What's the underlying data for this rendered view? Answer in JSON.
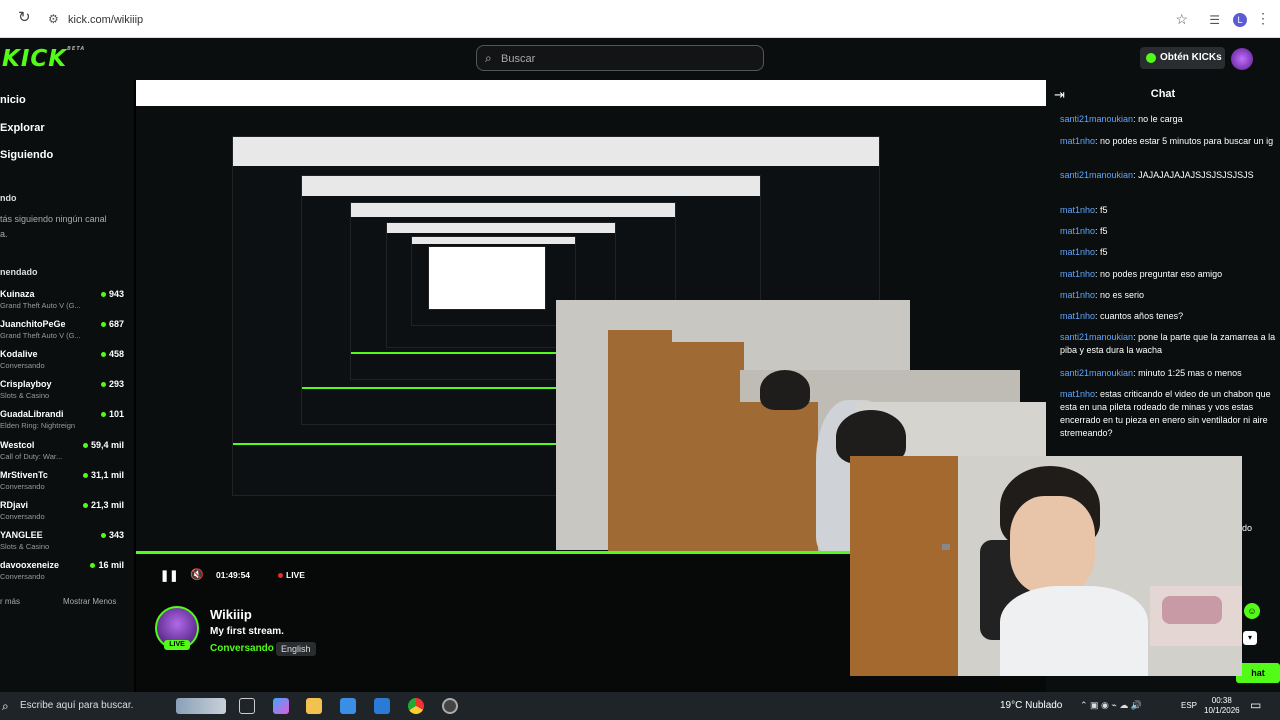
{
  "browser": {
    "url": "kick.com/wikiiip"
  },
  "header": {
    "logo": "KICK",
    "logo_beta": "BETA",
    "search_placeholder": "Buscar",
    "get_kicks": "Obtén KICKs",
    "accent": "#53fc18"
  },
  "sidebar": {
    "nav": [
      "nicio",
      "Explorar",
      "Siguiendo"
    ],
    "following_title": "ndo",
    "following_empty_1": "tás siguiendo ningún canal",
    "following_empty_2": "a.",
    "recommended_title": "nendado",
    "channels": [
      {
        "name": "Kuinaza",
        "game": "Grand Theft Auto V (G...",
        "viewers": "943"
      },
      {
        "name": "JuanchitoPeGe",
        "game": "Grand Theft Auto V (G...",
        "viewers": "687"
      },
      {
        "name": "Kodalive",
        "game": "Conversando",
        "viewers": "458"
      },
      {
        "name": "Crisplayboy",
        "game": "Slots & Casino",
        "viewers": "293"
      },
      {
        "name": "GuadaLibrandi",
        "game": "Elden Ring: Nightreign",
        "viewers": "101"
      },
      {
        "name": "Westcol",
        "game": "Call of Duty: War...",
        "viewers": "59,4 mil"
      },
      {
        "name": "MrStivenTc",
        "game": "Conversando",
        "viewers": "31,1 mil"
      },
      {
        "name": "RDjavi",
        "game": "Conversando",
        "viewers": "21,3 mil"
      },
      {
        "name": "YANGLEE",
        "game": "Slots & Casino",
        "viewers": "343"
      },
      {
        "name": "davooxeneize",
        "game": "Conversando",
        "viewers": "16 mil"
      }
    ],
    "show_more": "r más",
    "show_less": "Mostrar Menos"
  },
  "player": {
    "time": "01:49:54",
    "live": "LIVE"
  },
  "channel": {
    "name": "Wikiiip",
    "title": "My first stream.",
    "category": "Conversando",
    "language": "English",
    "live_badge": "LIVE"
  },
  "chat": {
    "title": "Chat",
    "messages": [
      {
        "user": "santi21manoukian",
        "text": ": no le carga"
      },
      {
        "user": "mat1nho",
        "text": ": no podes estar 5 minutos para buscar un ig"
      },
      {
        "user": "santi21manoukian",
        "text": ": JAJAJAJAJAJSJSJSJSJSJS"
      },
      {
        "user": "mat1nho",
        "text": ": f5"
      },
      {
        "user": "mat1nho",
        "text": ": f5"
      },
      {
        "user": "mat1nho",
        "text": ": f5"
      },
      {
        "user": "mat1nho",
        "text": ": no podes preguntar eso amigo"
      },
      {
        "user": "mat1nho",
        "text": ": no es serio"
      },
      {
        "user": "mat1nho",
        "text": ": cuantos años tenes?"
      },
      {
        "user": "santi21manoukian",
        "text": ": pone la parte que la zamarrea a la piba y esta dura la wacha"
      },
      {
        "user": "santi21manoukian",
        "text": ": minuto 1:25 mas o menos"
      },
      {
        "user": "mat1nho",
        "text": ": estas criticando el video de un chabon que esta en una pileta rodeado de minas y vos estas encerrado en tu pieza en enero sin ventilador ni aire stremeando?"
      }
    ],
    "chat_button": "hat",
    "partial_text": "do"
  },
  "taskbar": {
    "search": "Escribe aquí para buscar.",
    "weather": "19°C  Nublado",
    "lang": "ESP",
    "time": "00:38",
    "date": "10/1/2026"
  }
}
